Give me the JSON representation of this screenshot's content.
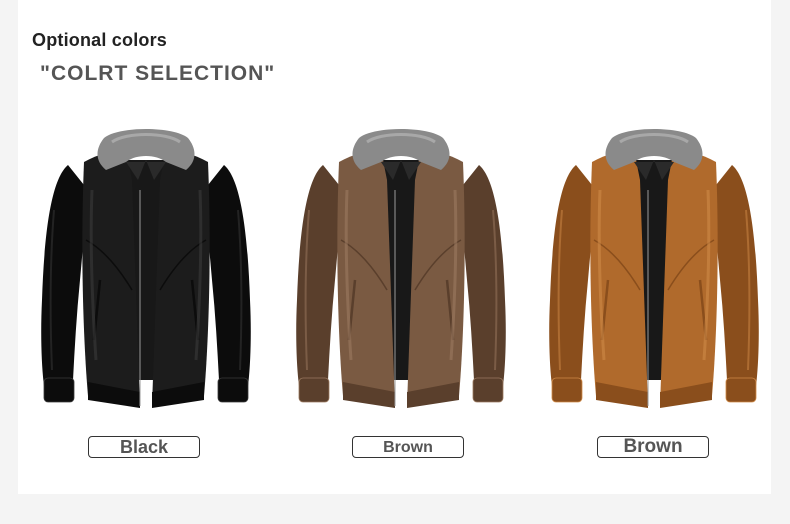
{
  "header": {
    "title": "Optional colors",
    "subtitle": "\"COLRT SELECTION\""
  },
  "products": [
    {
      "label": "Black",
      "icon": "black-leather-jacket-image",
      "color": "#1c1c1c",
      "shade": "#0c0c0c",
      "highlight": "#3a3a3a"
    },
    {
      "label": "Brown",
      "icon": "brown-leather-jacket-image",
      "color": "#7a5a42",
      "shade": "#5a3f2c",
      "highlight": "#9b7a60"
    },
    {
      "label": "Brown",
      "icon": "tan-leather-jacket-image",
      "color": "#b06a2c",
      "shade": "#8a4e1c",
      "highlight": "#cf8a48"
    }
  ]
}
